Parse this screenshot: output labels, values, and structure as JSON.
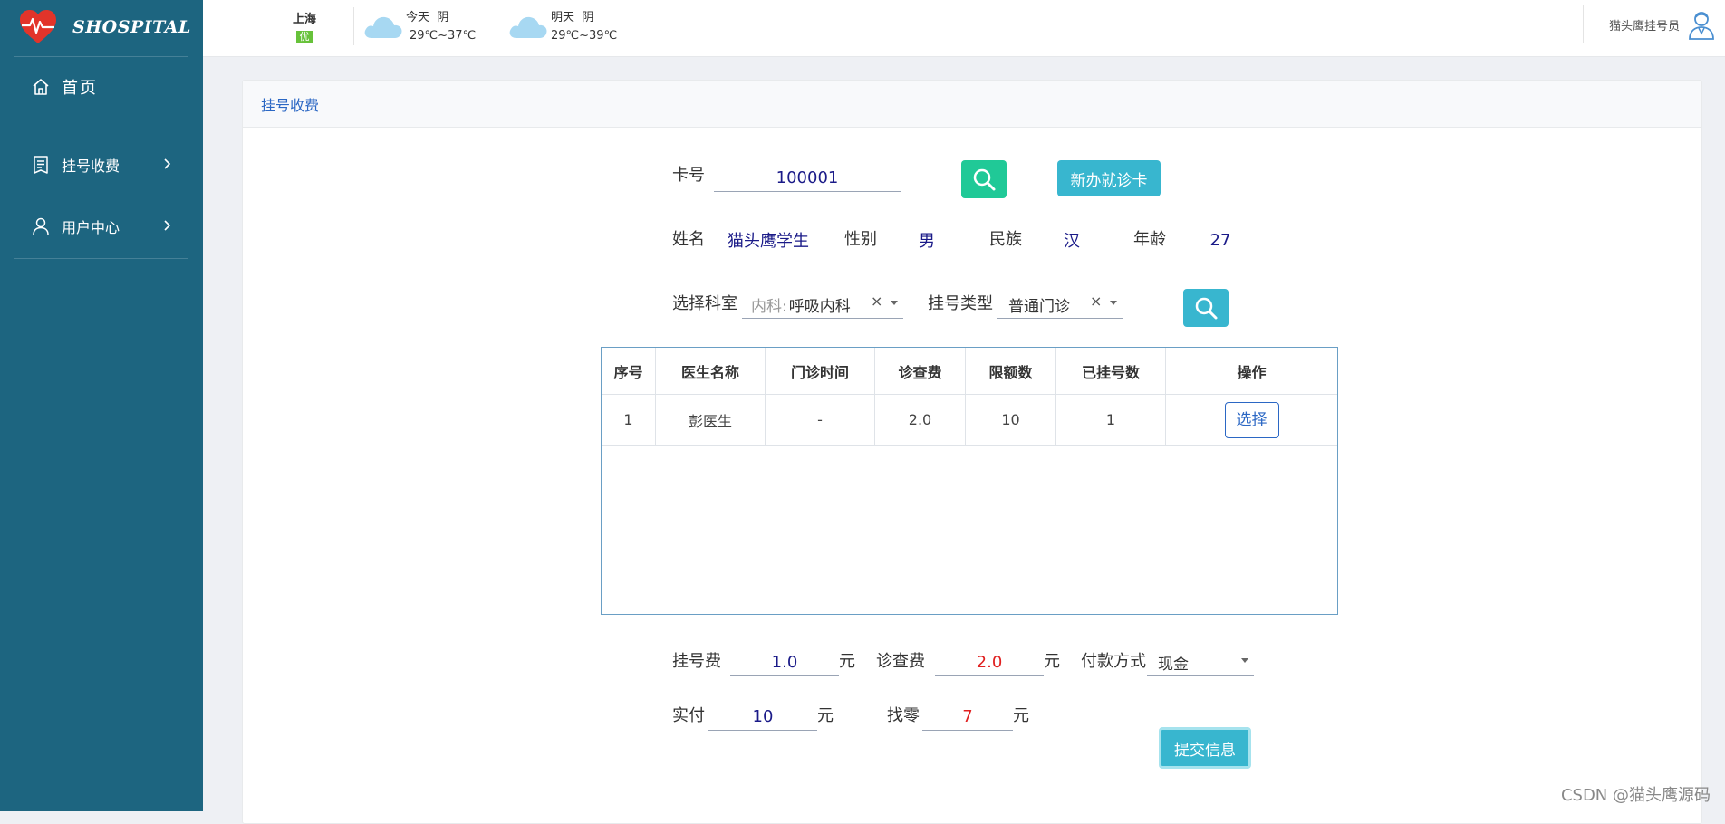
{
  "app": {
    "logo_text": "SHOSPITAL"
  },
  "sidebar": {
    "items": [
      {
        "label": "首页",
        "icon": "home-icon"
      },
      {
        "label": "挂号收费",
        "icon": "receipt-icon"
      },
      {
        "label": "用户中心",
        "icon": "user-icon"
      }
    ]
  },
  "header": {
    "city": "上海",
    "aqi": "优",
    "today": {
      "label": "今天",
      "condition": "阴",
      "temp": "29℃~37℃"
    },
    "tomorrow": {
      "label": "明天",
      "condition": "阴",
      "temp": "29℃~39℃"
    },
    "user_name": "猫头鹰挂号员"
  },
  "page": {
    "title": "挂号收费"
  },
  "form": {
    "card_label": "卡号",
    "card_value": "100001",
    "new_card_button": "新办就诊卡",
    "name_label": "姓名",
    "name_value": "猫头鹰学生",
    "gender_label": "性别",
    "gender_value": "男",
    "ethnicity_label": "民族",
    "ethnicity_value": "汉",
    "age_label": "年龄",
    "age_value": "27",
    "dept_label": "选择科室",
    "dept_prefix": "内科:",
    "dept_value": "呼吸内科",
    "reg_type_label": "挂号类型",
    "reg_type_value": "普通门诊"
  },
  "table": {
    "columns": [
      "序号",
      "医生名称",
      "门诊时间",
      "诊查费",
      "限额数",
      "已挂号数",
      "操作"
    ],
    "rows": [
      {
        "no": "1",
        "doctor": "彭医生",
        "time": "-",
        "fee": "2.0",
        "limit": "10",
        "registered": "1",
        "action": "选择"
      }
    ]
  },
  "payment": {
    "reg_fee_label": "挂号费",
    "reg_fee_value": "1.0",
    "exam_fee_label": "诊查费",
    "exam_fee_value": "2.0",
    "unit": "元",
    "pay_method_label": "付款方式",
    "pay_method_value": "现金",
    "paid_label": "实付",
    "paid_value": "10",
    "change_label": "找零",
    "change_value": "7",
    "submit_button": "提交信息"
  },
  "watermark": "CSDN @猫头鹰源码",
  "colors": {
    "sidebar": "#1d6580",
    "accent_blue": "#2b67c4",
    "search_green": "#20c997",
    "teal": "#38b6cf",
    "red_value": "#e02020"
  }
}
